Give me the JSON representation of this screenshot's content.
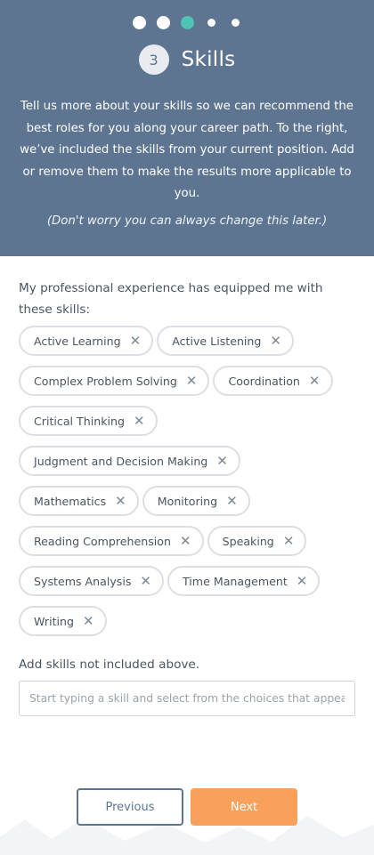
{
  "header": {
    "step_number": "3",
    "title": "Skills",
    "intro": "Tell us more about your skills so we can recommend the best roles for you along your career path. To the right, we’ve included the skills from your current position. Add or remove them to make the results more applicable to you.",
    "note": "(Don't worry you can always change this later.)"
  },
  "skills_section": {
    "label": "My professional experience has equipped me with these skills:",
    "skills": [
      "Active Learning",
      "Active Listening",
      "Complex Problem Solving",
      "Coordination",
      "Critical Thinking",
      "Judgment and Decision Making",
      "Mathematics",
      "Monitoring",
      "Reading Comprehension",
      "Speaking",
      "Systems Analysis",
      "Time Management",
      "Writing"
    ],
    "remove_glyph": "✕"
  },
  "add_section": {
    "label": "Add skills not included above.",
    "placeholder": "Start typing a skill and select from the choices that appear",
    "value": ""
  },
  "nav": {
    "previous_label": "Previous",
    "next_label": "Next"
  },
  "colors": {
    "header_bg": "#5d7591",
    "active_step": "#4fc3b4",
    "next_button": "#f8a15d"
  }
}
